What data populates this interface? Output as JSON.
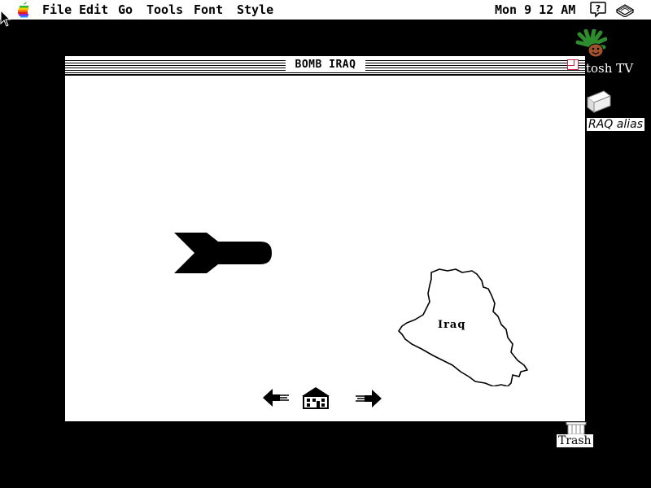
{
  "menubar": {
    "items": [
      "File",
      "Edit",
      "Go",
      "Tools",
      "Font",
      "Style"
    ],
    "clock": "Mon 9 12 AM",
    "help_icon": "help-question-icon",
    "app_icon": "finder-icon"
  },
  "window": {
    "title": "BOMB IRAQ"
  },
  "content": {
    "map_label": "Iraq",
    "nav": [
      "back-arrow-icon",
      "home-icon",
      "forward-arrow-icon"
    ]
  },
  "desktop": {
    "icons": [
      {
        "label": "tosh TV",
        "icon": "plant-tv-icon"
      },
      {
        "label": "RAQ alias",
        "icon": "stack-alias-icon"
      },
      {
        "label": "Trash",
        "icon": "trash-icon"
      }
    ]
  },
  "colors": {
    "desktop": "#000000",
    "window": "#ffffff",
    "apple_green": "#2eb82e",
    "apple_yellow": "#f5c800",
    "apple_orange": "#ff8000",
    "apple_red": "#e02020",
    "apple_purple": "#8a2be2",
    "apple_blue": "#1e90ff",
    "zoom_box": "#cc2244"
  }
}
